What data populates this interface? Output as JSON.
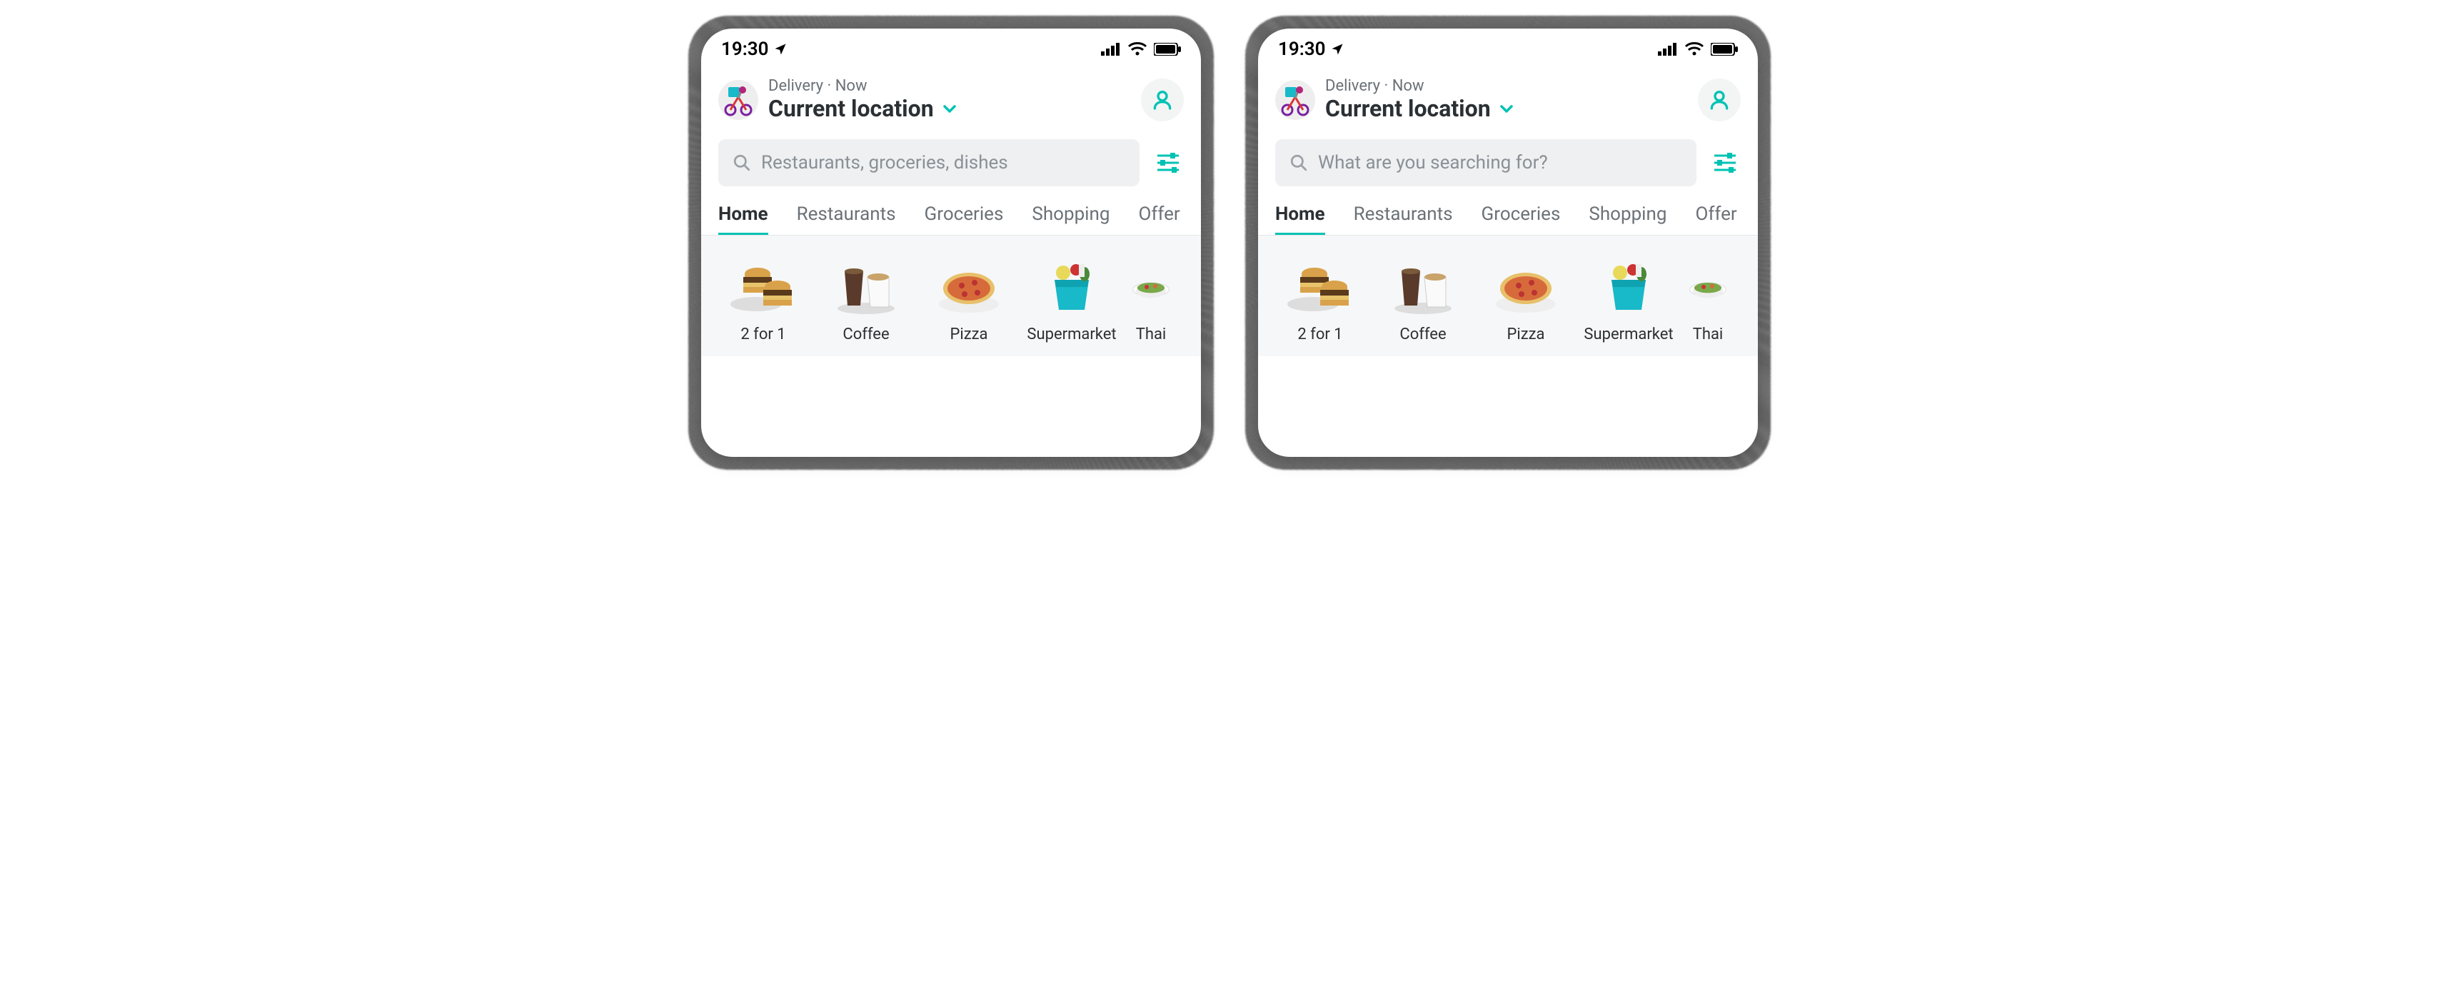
{
  "status": {
    "time": "19:30"
  },
  "header": {
    "delivery_label": "Delivery · Now",
    "location": "Current location"
  },
  "search": {
    "placeholder_a": "Restaurants, groceries, dishes",
    "placeholder_b": "What are you searching for?"
  },
  "tabs": [
    "Home",
    "Restaurants",
    "Groceries",
    "Shopping",
    "Offer"
  ],
  "active_tab_index": 0,
  "categories": [
    {
      "label": "2 for 1",
      "icon": "burger"
    },
    {
      "label": "Coffee",
      "icon": "coffee"
    },
    {
      "label": "Pizza",
      "icon": "pizza"
    },
    {
      "label": "Supermarket",
      "icon": "bag"
    },
    {
      "label": "Thai",
      "icon": "bowl"
    }
  ],
  "colors": {
    "accent": "#00c2b3"
  }
}
